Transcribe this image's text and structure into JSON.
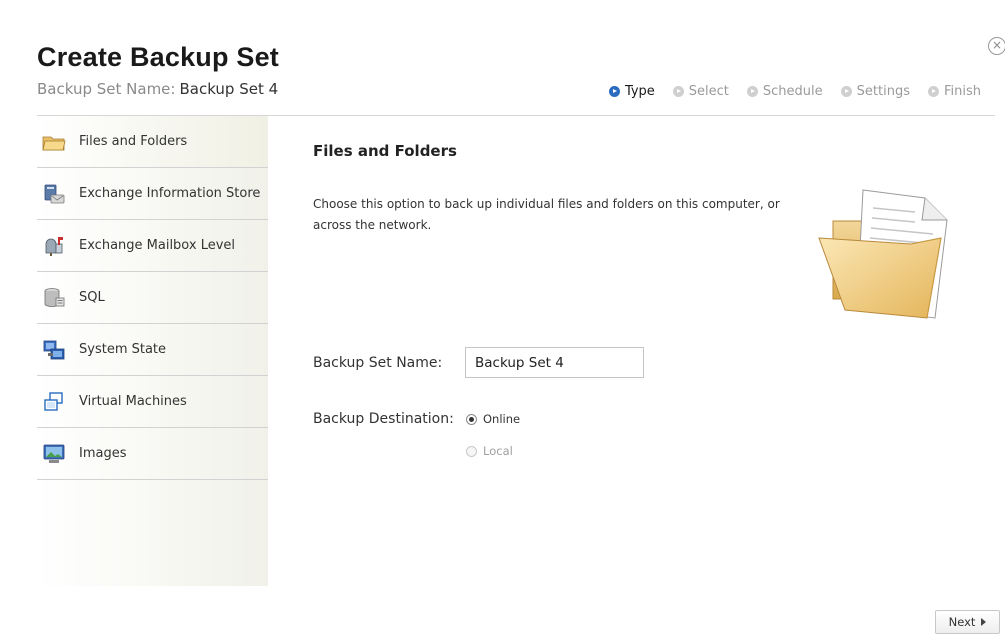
{
  "dialog": {
    "title": "Create Backup Set",
    "subtitle_label": "Backup Set Name:",
    "subtitle_value": "Backup Set 4"
  },
  "steps": [
    {
      "label": "Type",
      "active": true
    },
    {
      "label": "Select",
      "active": false
    },
    {
      "label": "Schedule",
      "active": false
    },
    {
      "label": "Settings",
      "active": false
    },
    {
      "label": "Finish",
      "active": false
    }
  ],
  "sidebar": {
    "items": [
      {
        "label": "Files and Folders",
        "icon": "folder-icon",
        "selected": true
      },
      {
        "label": "Exchange Information Store",
        "icon": "exchange-store-icon"
      },
      {
        "label": "Exchange Mailbox Level",
        "icon": "mailbox-icon"
      },
      {
        "label": "SQL",
        "icon": "database-icon"
      },
      {
        "label": "System State",
        "icon": "system-state-icon"
      },
      {
        "label": "Virtual Machines",
        "icon": "virtual-machines-icon"
      },
      {
        "label": "Images",
        "icon": "images-icon"
      }
    ]
  },
  "panel": {
    "title": "Files and Folders",
    "description": "Choose this option to back up individual files and folders on this computer, or across the network.",
    "name_label": "Backup Set Name:",
    "name_value": "Backup Set 4",
    "destination_label": "Backup Destination:",
    "destinations": [
      {
        "label": "Online",
        "checked": true,
        "disabled": false
      },
      {
        "label": "Local",
        "checked": false,
        "disabled": true
      }
    ]
  },
  "footer": {
    "next_label": "Next"
  }
}
